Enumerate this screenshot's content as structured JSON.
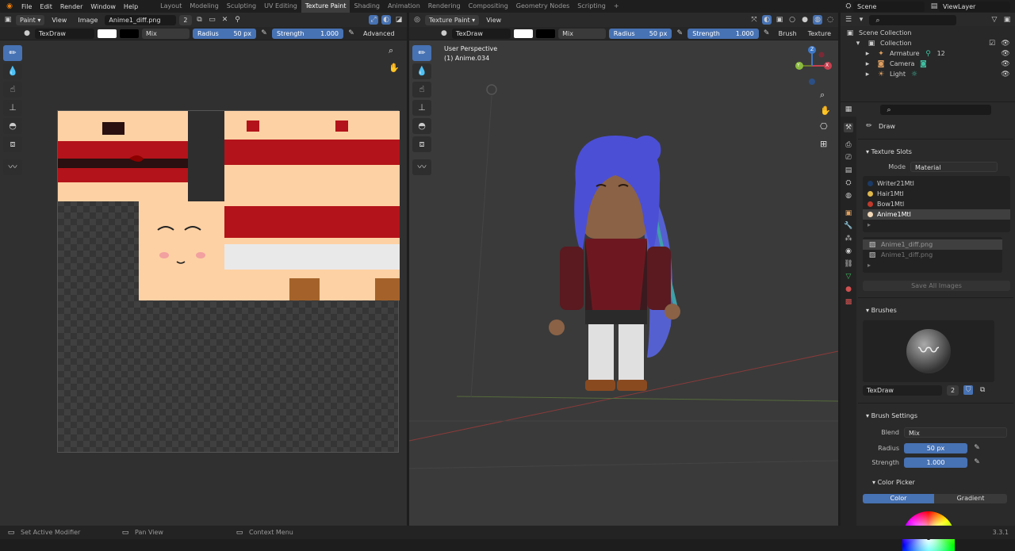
{
  "menu": {
    "items": [
      "File",
      "Edit",
      "Render",
      "Window",
      "Help"
    ]
  },
  "workspaces": {
    "tabs": [
      "Layout",
      "Modeling",
      "Sculpting",
      "UV Editing",
      "Texture Paint",
      "Shading",
      "Animation",
      "Rendering",
      "Compositing",
      "Geometry Nodes",
      "Scripting"
    ],
    "plus": "+"
  },
  "scene": {
    "label": "Scene"
  },
  "view_layer": {
    "label": "ViewLayer"
  },
  "image_editor": {
    "mode": "Paint",
    "view": "View",
    "image_menu": "Image",
    "image_name": "Anime1_diff.png",
    "users": "2"
  },
  "image_tool": {
    "brush": "TexDraw",
    "blend": "Mix",
    "radius_label": "Radius",
    "radius_value": "50 px",
    "strength_label": "Strength",
    "strength_value": "1.000",
    "advanced": "Advanced"
  },
  "viewport": {
    "mode": "Texture Paint",
    "view": "View",
    "perspective": "User Perspective",
    "object": "(1) Anime.034"
  },
  "viewport_tool": {
    "brush": "TexDraw",
    "blend": "Mix",
    "radius_label": "Radius",
    "radius_value": "50 px",
    "strength_label": "Strength",
    "strength_value": "1.000",
    "brush_menu": "Brush",
    "texture_menu": "Texture"
  },
  "gizmo": {
    "x": "X",
    "y": "Y",
    "z": "Z"
  },
  "outliner": {
    "root": "Scene Collection",
    "collection": "Collection",
    "items": [
      "Armature",
      "Camera",
      "Light"
    ],
    "armature_count": "12"
  },
  "props": {
    "tool_name": "Draw",
    "texture_slots": {
      "title": "Texture Slots",
      "mode_label": "Mode",
      "mode_value": "Material",
      "slots": [
        "Writer21Mtl",
        "Hair1Mtl",
        "Bow1Mtl",
        "Anime1Mtl"
      ],
      "images": [
        "Anime1_diff.png",
        "Anime1_diff.png"
      ],
      "save_all": "Save All Images"
    },
    "brushes": {
      "title": "Brushes",
      "brush_name": "TexDraw",
      "users": "2"
    },
    "brush_settings": {
      "title": "Brush Settings",
      "blend_label": "Blend",
      "blend_value": "Mix",
      "radius_label": "Radius",
      "radius_value": "50 px",
      "strength_label": "Strength",
      "strength_value": "1.000"
    },
    "color_picker": {
      "title": "Color Picker",
      "tab_color": "Color",
      "tab_gradient": "Gradient"
    }
  },
  "status": {
    "left": "Set Active Modifier",
    "middle": "Pan View",
    "right": "Context Menu",
    "version": "3.3.1"
  },
  "colors": {
    "accent": "#4772b3",
    "slot_colors": [
      "#1b3a66",
      "#e0b84a",
      "#c0392b",
      "#f3d9b8"
    ]
  }
}
